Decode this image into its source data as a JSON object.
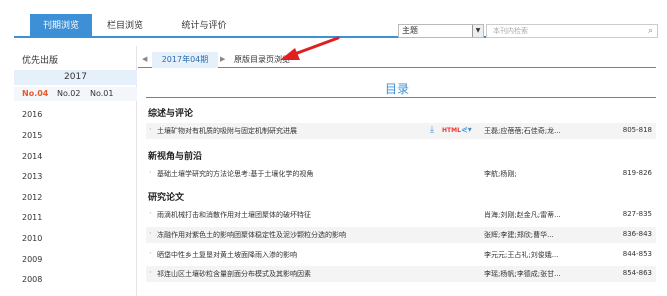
{
  "tabs": [
    {
      "label": "刊期浏览",
      "active": true
    },
    {
      "label": "栏目浏览",
      "active": false
    },
    {
      "label": "统计与评价",
      "active": false
    }
  ],
  "search": {
    "select_value": "主题",
    "placeholder": "本刊内检索"
  },
  "sidebar": {
    "priority_label": "优先出版",
    "current_year": "2017",
    "issues": [
      "No.04",
      "No.02",
      "No.01"
    ],
    "years": [
      "2016",
      "2015",
      "2014",
      "2013",
      "2012",
      "2011",
      "2010",
      "2009",
      "2008"
    ]
  },
  "subtabs": {
    "current": "2017年04期",
    "link": "原版目录页浏览"
  },
  "toc": {
    "title": "目录",
    "sections": [
      {
        "name": "综述与评论",
        "rows": [
          {
            "title": "土壤矿物对有机质的吸附与固定机制研究进展",
            "authors": "王磊;应蓓蓓;石佳奇;龙...",
            "pages": "805-818",
            "tools": true
          }
        ]
      },
      {
        "name": "新视角与前沿",
        "rows": [
          {
            "title": "基础土壤学研究的方法论思考:基于土壤化学的视角",
            "authors": "李航;杨刚;",
            "pages": "819-826",
            "tools": false
          }
        ]
      },
      {
        "name": "研究论文",
        "rows": [
          {
            "title": "雨滴机械打击和消散作用对土壤团聚体的破坏特征",
            "authors": "肖海;刘刚;赵金凡;雷蒂...",
            "pages": "827-835",
            "tools": false
          },
          {
            "title": "冻融作用对紫色土的影响团聚体稳定性及泥沙颗粒分选的影响",
            "authors": "张辉;李建;郑欣;曹华...",
            "pages": "836-843",
            "tools": false
          },
          {
            "title": "晒垡中性乡土复垦对黄土坡面降雨入渗的影响",
            "authors": "李元元;王占礼;刘俊娥...",
            "pages": "844-853",
            "tools": false
          },
          {
            "title": "祁连山区土壤砂粒含量剖面分布模式及其影响因素",
            "authors": "李瑶;杨帆;李德成;张甘...",
            "pages": "854-863",
            "tools": false
          }
        ]
      }
    ]
  },
  "icons": {
    "download": "download-icon",
    "html": "HTML",
    "share": "share-icon"
  },
  "colors": {
    "accent": "#3d8fd6",
    "selected_issue": "#e85a2a",
    "annotation_arrow": "#e02020"
  }
}
